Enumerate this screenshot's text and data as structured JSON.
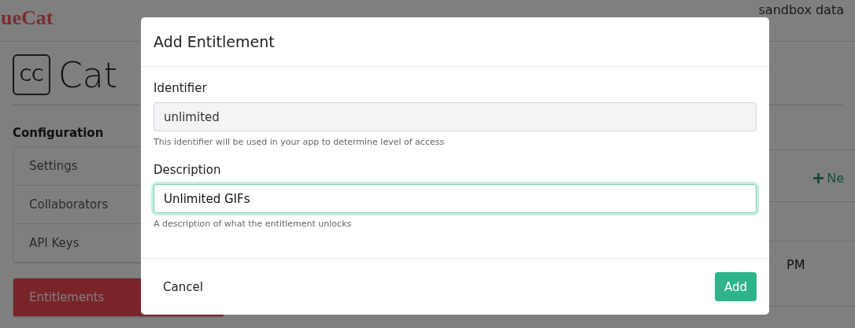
{
  "header": {
    "logo": "ueCat",
    "sandbox_label": "sandbox data"
  },
  "app": {
    "badge": "CC",
    "title": "Cat"
  },
  "sidebar": {
    "heading": "Configuration",
    "groups": [
      [
        {
          "label": "Settings",
          "selected": false
        },
        {
          "label": "Collaborators",
          "selected": false
        },
        {
          "label": "API Keys",
          "selected": false
        }
      ],
      [
        {
          "label": "Entitlements",
          "selected": true
        }
      ]
    ]
  },
  "content": {
    "new_button": "Ne",
    "row_text": "PM"
  },
  "modal": {
    "title": "Add Entitlement",
    "fields": [
      {
        "label": "Identifier",
        "value": "unlimited",
        "help": "This identifier will be used in your app to determine level of access",
        "disabled": true,
        "focused": false
      },
      {
        "label": "Description",
        "value": "Unlimited GIFs",
        "help": "A description of what the entitlement unlocks",
        "disabled": false,
        "focused": true
      }
    ],
    "cancel": "Cancel",
    "submit": "Add"
  }
}
